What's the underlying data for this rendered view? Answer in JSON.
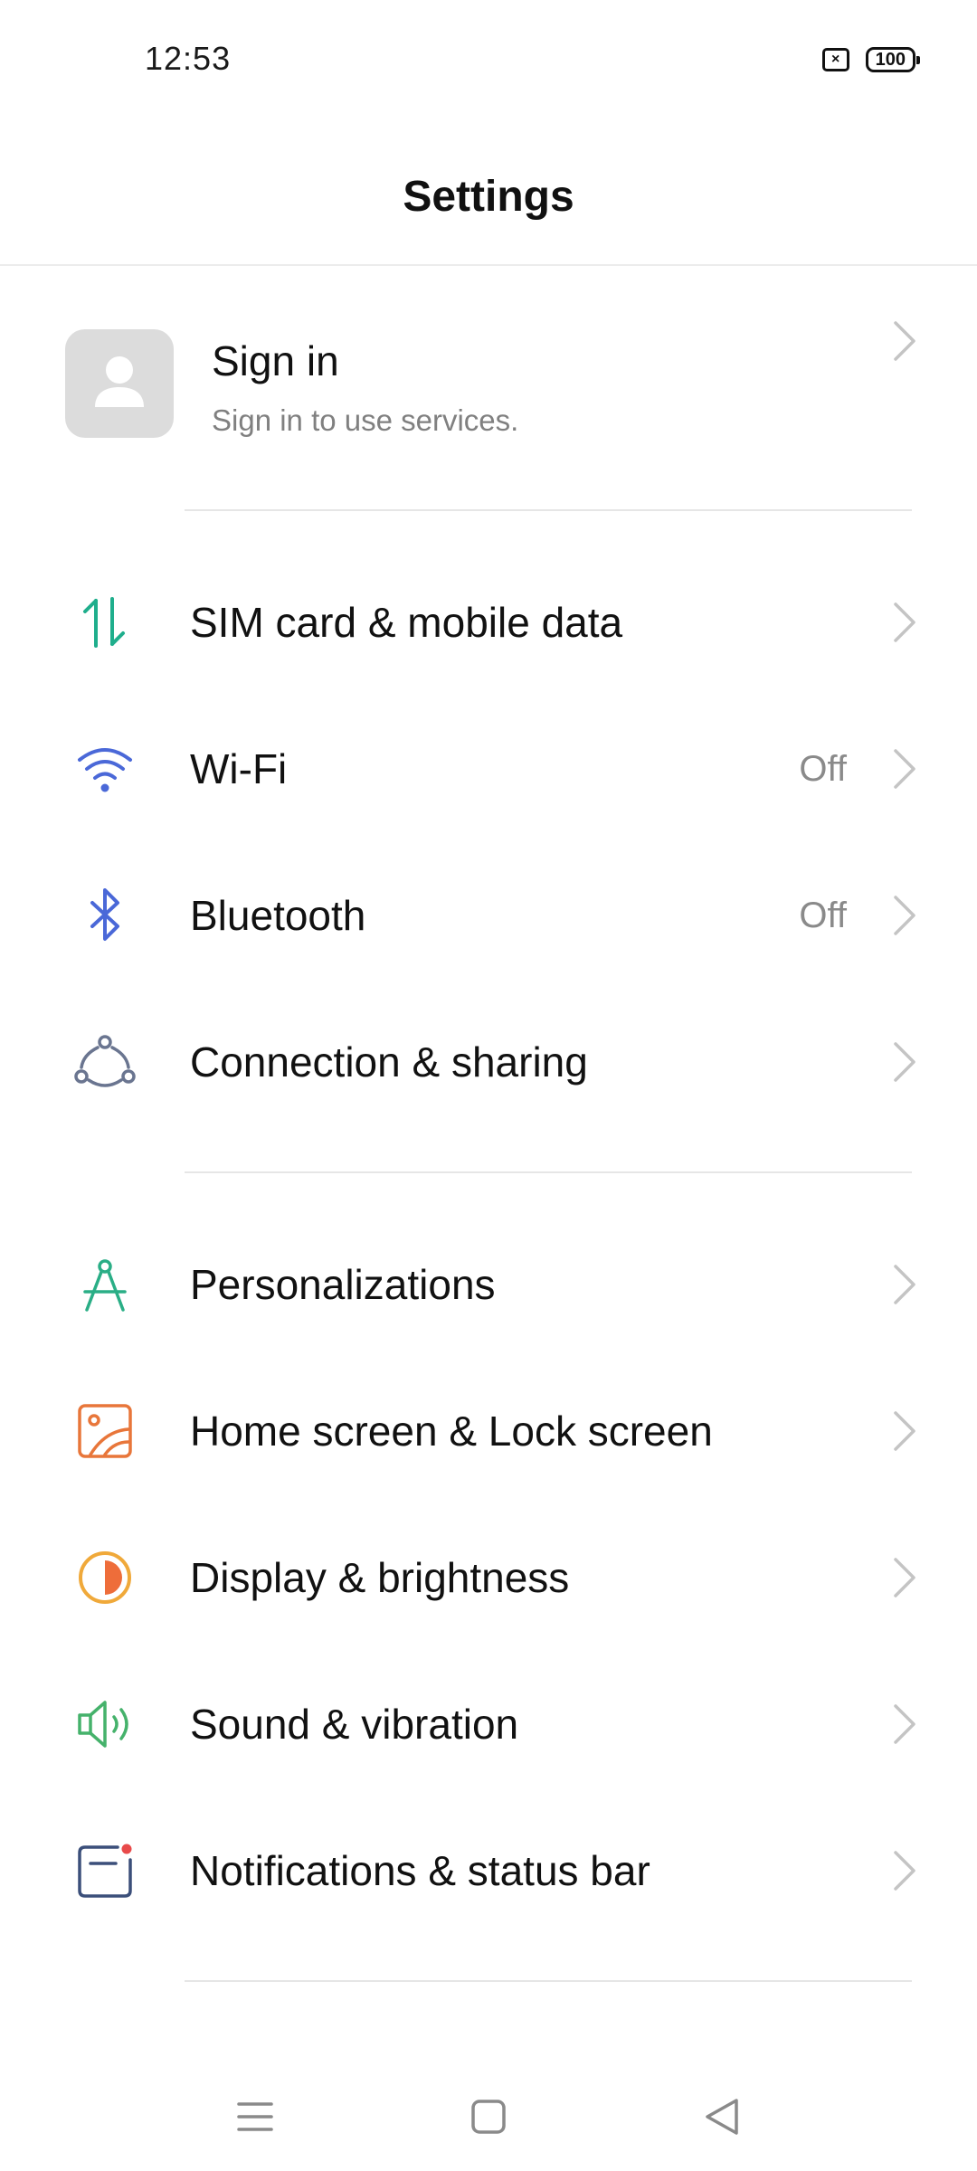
{
  "status_bar": {
    "time": "12:53",
    "sim_icon": "sim-x-icon",
    "battery": "100"
  },
  "header": {
    "title": "Settings"
  },
  "account": {
    "title": "Sign in",
    "subtitle": "Sign in to use services.",
    "icon": "person-icon"
  },
  "groups": [
    {
      "items": [
        {
          "label": "SIM card & mobile data",
          "value": "",
          "icon": "mobile-data-icon",
          "color": "#1fae8c"
        },
        {
          "label": "Wi-Fi",
          "value": "Off",
          "icon": "wifi-icon",
          "color": "#4a68d8"
        },
        {
          "label": "Bluetooth",
          "value": "Off",
          "icon": "bluetooth-icon",
          "color": "#4a68d8"
        },
        {
          "label": "Connection & sharing",
          "value": "",
          "icon": "connection-icon",
          "color": "#6a7590"
        }
      ]
    },
    {
      "items": [
        {
          "label": "Personalizations",
          "value": "",
          "icon": "compass-icon",
          "color": "#2aae86"
        },
        {
          "label": "Home screen & Lock screen",
          "value": "",
          "icon": "wallpaper-icon",
          "color": "#e8763a"
        },
        {
          "label": "Display & brightness",
          "value": "",
          "icon": "brightness-icon",
          "color": "#f0a93a"
        },
        {
          "label": "Sound & vibration",
          "value": "",
          "icon": "speaker-icon",
          "color": "#45b26b"
        },
        {
          "label": "Notifications & status bar",
          "value": "",
          "icon": "notification-icon",
          "color": "#3b4f7a"
        }
      ]
    }
  ],
  "nav": {
    "menu": "menu-icon",
    "home": "home-icon",
    "back": "back-icon"
  }
}
